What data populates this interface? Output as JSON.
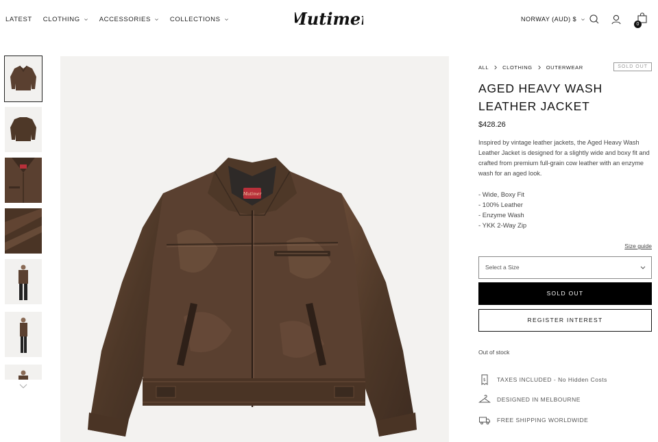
{
  "nav": {
    "items": [
      {
        "label": "LATEST",
        "has_dropdown": false
      },
      {
        "label": "CLOTHING",
        "has_dropdown": true
      },
      {
        "label": "ACCESSORIES",
        "has_dropdown": true
      },
      {
        "label": "COLLECTIONS",
        "has_dropdown": true
      }
    ]
  },
  "brand": {
    "logo_text": "Mutimer"
  },
  "header": {
    "region_label": "NORWAY (AUD) $",
    "cart_count": "0",
    "icons": [
      "search-icon",
      "account-icon",
      "cart-icon"
    ]
  },
  "gallery": {
    "thumbnails": [
      "jacket-front",
      "jacket-back",
      "jacket-collar-detail",
      "leather-texture",
      "model-front",
      "model-side",
      "model-partial"
    ],
    "active_index": 0
  },
  "product": {
    "breadcrumb": [
      "ALL",
      "CLOTHING",
      "OUTERWEAR"
    ],
    "badge": "SOLD OUT",
    "title": "AGED HEAVY WASH LEATHER JACKET",
    "price": "$428.26",
    "description": "Inspired by vintage leather jackets, the Aged Heavy Wash Leather Jacket is designed for a slightly wide and boxy fit and crafted from premium full-grain cow leather with an enzyme wash for an aged look.",
    "features": [
      "- Wide, Boxy Fit",
      "- 100% Leather",
      "- Enzyme Wash",
      "- YKK 2-Way Zip"
    ],
    "size_guide_label": "Size guide",
    "size_select_placeholder": "Select a Size",
    "sold_out_button": "SOLD OUT",
    "register_button": "REGISTER INTEREST",
    "stock_status": "Out of stock",
    "perks": [
      {
        "icon": "receipt-icon",
        "label": "TAXES INCLUDED - No Hidden Costs"
      },
      {
        "icon": "hanger-icon",
        "label": "DESIGNED IN MELBOURNE"
      },
      {
        "icon": "truck-icon",
        "label": "FREE SHIPPING WORLDWIDE"
      }
    ],
    "label_text": "Mutimer"
  },
  "colors": {
    "leather_dark": "#3d2b20",
    "leather_mid": "#5a4030",
    "leather_light": "#7a5a44",
    "label_red": "#b8303a",
    "button_black": "#000000",
    "image_bg": "#f3f2f0"
  }
}
